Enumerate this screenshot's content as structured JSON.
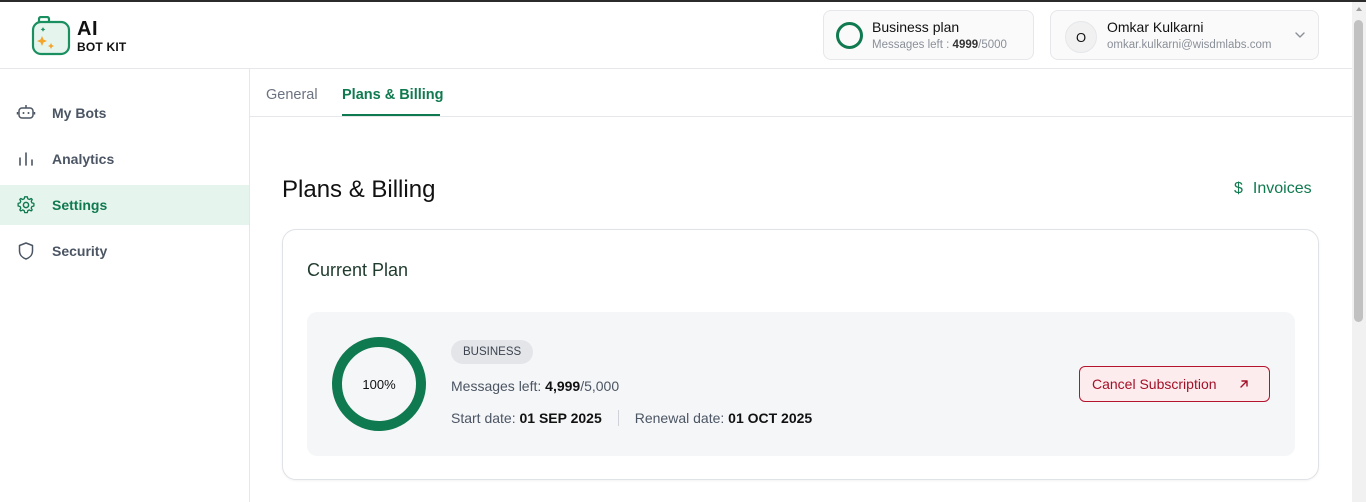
{
  "brand": {
    "line1": "AI",
    "line2": "BOT KIT"
  },
  "plan_chip": {
    "title": "Business plan",
    "sub_prefix": "Messages left : ",
    "remaining": "4999",
    "total": "/5000"
  },
  "user": {
    "initial": "O",
    "name": "Omkar Kulkarni",
    "email": "omkar.kulkarni@wisdmlabs.com"
  },
  "sidebar": {
    "items": [
      {
        "label": "My Bots",
        "icon": "bot-icon"
      },
      {
        "label": "Analytics",
        "icon": "bar-chart-icon"
      },
      {
        "label": "Settings",
        "icon": "gear-icon",
        "active": true
      },
      {
        "label": "Security",
        "icon": "shield-icon"
      }
    ]
  },
  "tabs": [
    {
      "label": "General"
    },
    {
      "label": "Plans & Billing",
      "active": true
    }
  ],
  "page": {
    "title": "Plans & Billing",
    "invoices_label": "Invoices",
    "dollar_icon": "$"
  },
  "current_plan": {
    "title": "Current Plan",
    "percent_label": "100%",
    "percent": 1.0,
    "badge": "BUSINESS",
    "messages_label": "Messages left: ",
    "messages_value": "4,999",
    "messages_total": "/5,000",
    "start_label": "Start date: ",
    "start_value": "01 SEP 2025",
    "renewal_label": "Renewal date: ",
    "renewal_value": "01 OCT 2025",
    "cancel_label": "Cancel Subscription"
  },
  "colors": {
    "accent": "#0f7a4f",
    "danger": "#b4152d",
    "active_bg": "#e6f4ee"
  }
}
